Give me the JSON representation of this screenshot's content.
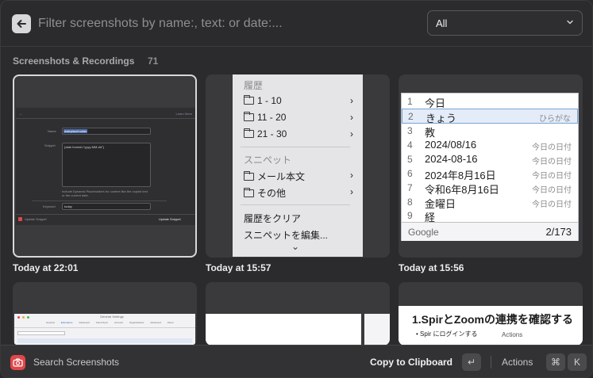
{
  "search": {
    "placeholder": "Filter screenshots by name:, text: or date:...",
    "filter_value": "All"
  },
  "section": {
    "title": "Screenshots & Recordings",
    "count": "71"
  },
  "tiles": [
    {
      "caption": "Today at 22:01",
      "content": {
        "header_link": "Learn More",
        "name_label": "Name",
        "name_value": "dateplaceholder",
        "snippet_label": "Snippet",
        "snippet_value": "{date format=\"yyyy-MM-dd\"}",
        "hint": "Include Dynamic Placeholders for context like the copied text or the current date.",
        "keyword_label": "Keyword",
        "keyword_value": "today",
        "footer_left": "Update Snippet",
        "footer_right": "Update Snippet"
      }
    },
    {
      "caption": "Today at 15:57",
      "menu": {
        "history_header": "履歴",
        "history_items": [
          "1 - 10",
          "11 - 20",
          "21 - 30"
        ],
        "snippet_header": "スニペット",
        "snippet_items": [
          "メール本文",
          "その他"
        ],
        "clear_history": "履歴をクリア",
        "edit_snippets": "スニペットを編集...",
        "more": "⌄"
      }
    },
    {
      "caption": "Today at 15:56",
      "ime": {
        "rows": [
          {
            "n": "1",
            "word": "今日",
            "hint": ""
          },
          {
            "n": "2",
            "word": "きょう",
            "hint": "ひらがな"
          },
          {
            "n": "3",
            "word": "教",
            "hint": ""
          },
          {
            "n": "4",
            "word": "2024/08/16",
            "hint": "今日の日付"
          },
          {
            "n": "5",
            "word": "2024-08-16",
            "hint": "今日の日付"
          },
          {
            "n": "6",
            "word": "2024年8月16日",
            "hint": "今日の日付"
          },
          {
            "n": "7",
            "word": "令和6年8月16日",
            "hint": "今日の日付"
          },
          {
            "n": "8",
            "word": "金曜日",
            "hint": "今日の日付"
          },
          {
            "n": "9",
            "word": "経",
            "hint": ""
          }
        ],
        "footer_brand": "Google",
        "footer_page": "2/173"
      }
    },
    {
      "caption": "",
      "tabs": [
        "General",
        "Extensions",
        "Advanced",
        "Cloud Sync",
        "Account",
        "Organizations",
        "Advanced",
        "About"
      ],
      "title": "General Settings"
    },
    {
      "caption": ""
    },
    {
      "caption": "",
      "heading": "1.SpirとZoomの連携を確認する",
      "bullet": "Spir にログインする",
      "extra": "Actions"
    }
  ],
  "bottombar": {
    "title": "Search Screenshots",
    "primary_action": "Copy to Clipboard",
    "primary_key": "↵",
    "actions_label": "Actions",
    "actions_key_1": "⌘",
    "actions_key_2": "K"
  },
  "colors": {
    "background": "#2b2b2d",
    "app_icon": "#e0474a",
    "selected_border": "#d8d8da"
  }
}
